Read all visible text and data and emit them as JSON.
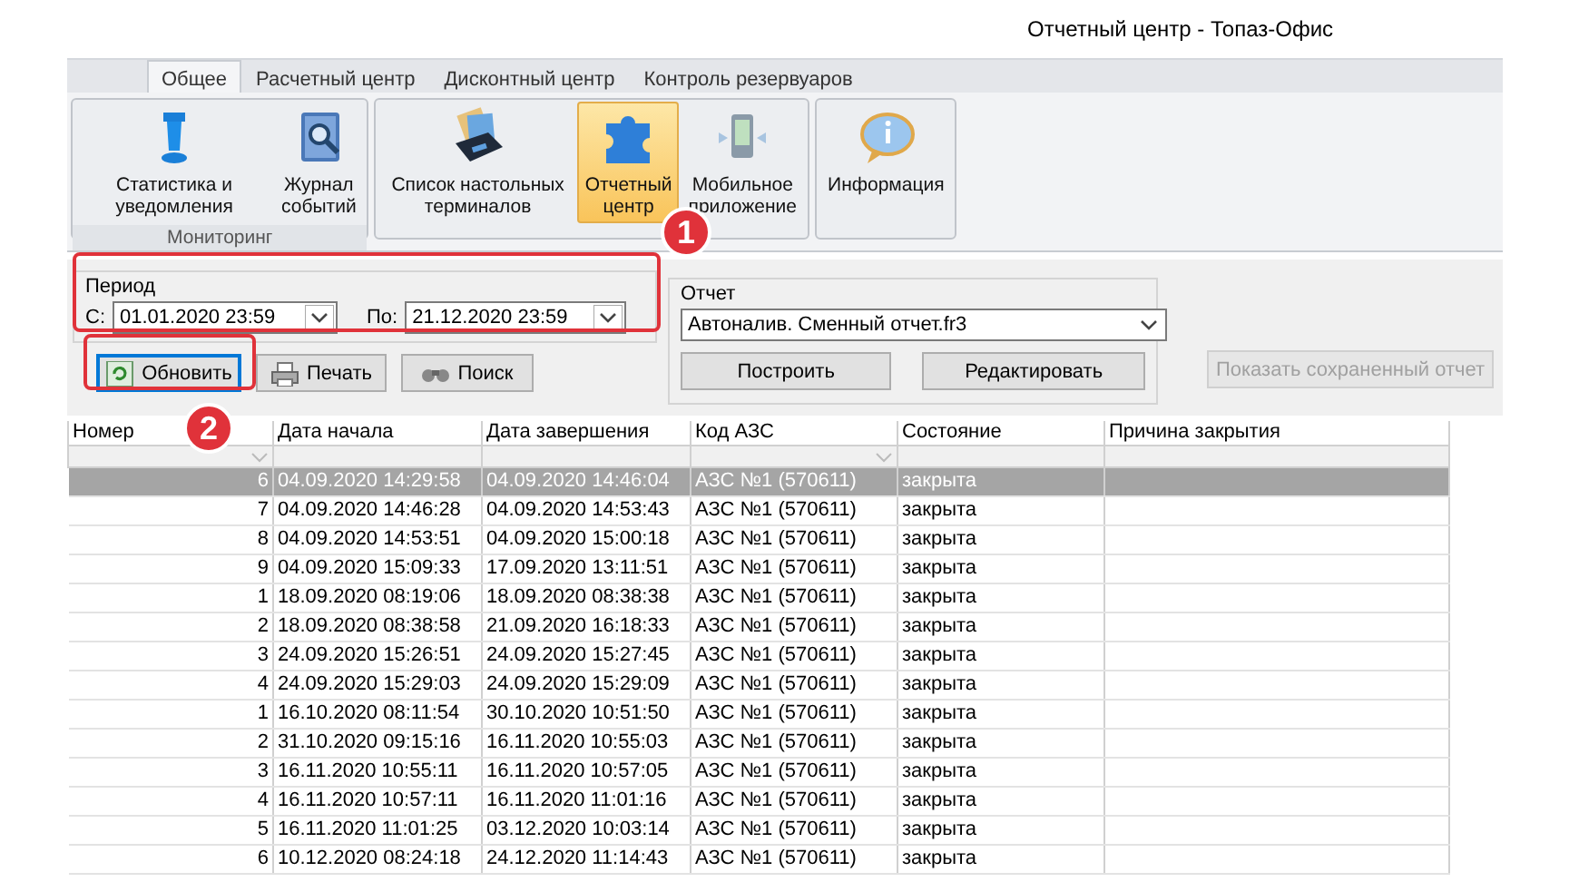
{
  "window": {
    "title": "Отчетный центр - Топаз-Офис"
  },
  "ribbon_tabs": [
    {
      "label": "Общее",
      "selected": true
    },
    {
      "label": "Расчетный центр",
      "selected": false
    },
    {
      "label": "Дисконтный центр",
      "selected": false
    },
    {
      "label": "Контроль резервуаров",
      "selected": false
    }
  ],
  "ribbon_groups": [
    {
      "label": "Мониторинг",
      "items": [
        {
          "label": "Статистика и уведомления",
          "selected": false
        },
        {
          "label": "Журнал событий",
          "selected": false
        }
      ]
    },
    {
      "items": [
        {
          "label": "Список настольных терминалов",
          "selected": false
        },
        {
          "label": "Отчетный центр",
          "selected": true
        },
        {
          "label": "Мобильное приложение",
          "selected": false
        }
      ]
    },
    {
      "items": [
        {
          "label": "Информация",
          "selected": false
        }
      ]
    }
  ],
  "period": {
    "title": "Период",
    "from_label": "С:",
    "from_value": "01.01.2020 23:59",
    "to_label": "По:",
    "to_value": "21.12.2020 23:59"
  },
  "actions": [
    {
      "label": "Обновить",
      "selected": true
    },
    {
      "label": "Печать",
      "selected": false
    },
    {
      "label": "Поиск",
      "selected": false
    }
  ],
  "report": {
    "title": "Отчет",
    "value": "Автоналив. Сменный отчет.fr3",
    "buttons": [
      "Построить",
      "Редактировать"
    ]
  },
  "saved_report_button": {
    "label": "Показать сохраненный отчет",
    "disabled": true
  },
  "callouts": [
    "1",
    "2"
  ],
  "table": {
    "columns": [
      "Номер",
      "Дата начала",
      "Дата завершения",
      "Код АЗС",
      "Состояние",
      "Причина закрытия"
    ],
    "rows": [
      {
        "cells": [
          "6",
          "04.09.2020 14:29:58",
          "04.09.2020 14:46:04",
          "АЗС №1 (570611)",
          "закрыта"
        ],
        "selected": true
      },
      {
        "cells": [
          "7",
          "04.09.2020 14:46:28",
          "04.09.2020 14:53:43",
          "АЗС №1 (570611)",
          "закрыта"
        ],
        "selected": false
      },
      {
        "cells": [
          "8",
          "04.09.2020 14:53:51",
          "04.09.2020 15:00:18",
          "АЗС №1 (570611)",
          "закрыта"
        ],
        "selected": false
      },
      {
        "cells": [
          "9",
          "04.09.2020 15:09:33",
          "17.09.2020 13:11:51",
          "АЗС №1 (570611)",
          "закрыта"
        ],
        "selected": false
      },
      {
        "cells": [
          "1",
          "18.09.2020 08:19:06",
          "18.09.2020 08:38:38",
          "АЗС №1 (570611)",
          "закрыта"
        ],
        "selected": false
      },
      {
        "cells": [
          "2",
          "18.09.2020 08:38:58",
          "21.09.2020 16:18:33",
          "АЗС №1 (570611)",
          "закрыта"
        ],
        "selected": false
      },
      {
        "cells": [
          "3",
          "24.09.2020 15:26:51",
          "24.09.2020 15:27:45",
          "АЗС №1 (570611)",
          "закрыта"
        ],
        "selected": false
      },
      {
        "cells": [
          "4",
          "24.09.2020 15:29:03",
          "24.09.2020 15:29:09",
          "АЗС №1 (570611)",
          "закрыта"
        ],
        "selected": false
      },
      {
        "cells": [
          "1",
          "16.10.2020 08:11:54",
          "30.10.2020 10:51:50",
          "АЗС №1 (570611)",
          "закрыта"
        ],
        "selected": false
      },
      {
        "cells": [
          "2",
          "31.10.2020 09:15:16",
          "16.11.2020 10:55:03",
          "АЗС №1 (570611)",
          "закрыта"
        ],
        "selected": false
      },
      {
        "cells": [
          "3",
          "16.11.2020 10:55:11",
          "16.11.2020 10:57:05",
          "АЗС №1 (570611)",
          "закрыта"
        ],
        "selected": false
      },
      {
        "cells": [
          "4",
          "16.11.2020 10:57:11",
          "16.11.2020 11:01:16",
          "АЗС №1 (570611)",
          "закрыта"
        ],
        "selected": false
      },
      {
        "cells": [
          "5",
          "16.11.2020 11:01:25",
          "03.12.2020 10:03:14",
          "АЗС №1 (570611)",
          "закрыта"
        ],
        "selected": false
      },
      {
        "cells": [
          "6",
          "10.12.2020 08:24:18",
          "24.12.2020 11:14:43",
          "АЗС №1 (570611)",
          "закрыта"
        ],
        "selected": false
      }
    ]
  }
}
